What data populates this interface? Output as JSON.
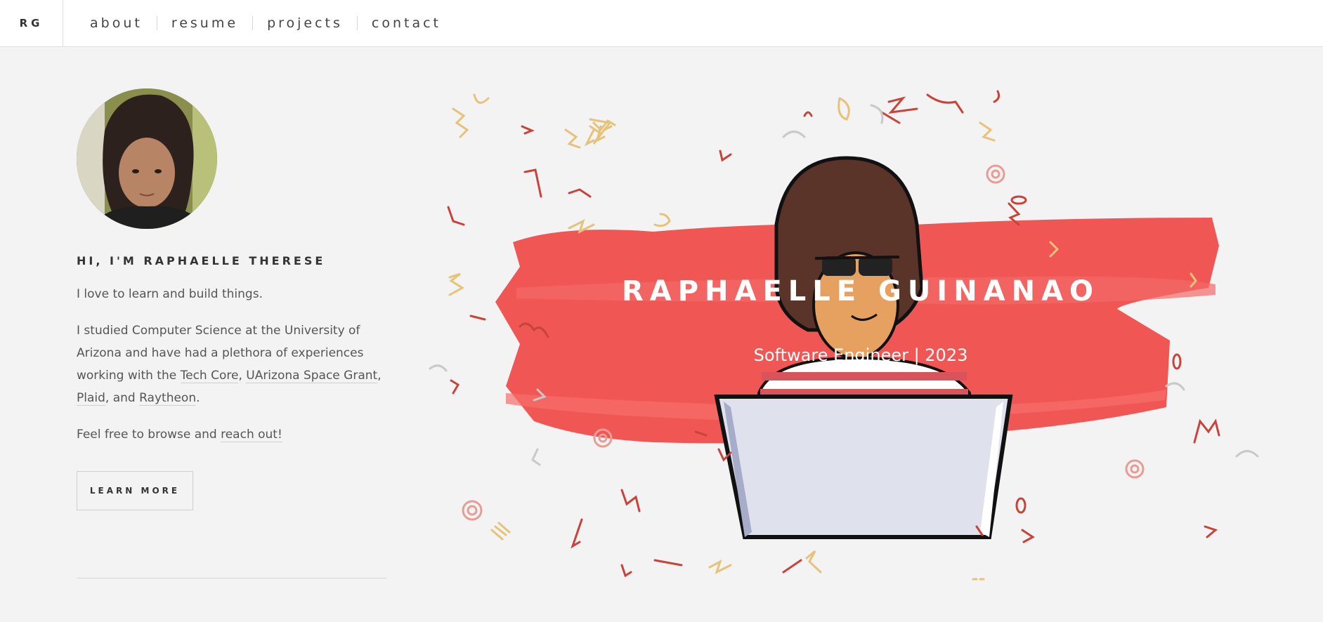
{
  "nav": {
    "brand": "RG",
    "items": [
      "about",
      "resume",
      "projects",
      "contact"
    ]
  },
  "intro": {
    "heading": "HI, I'M RAPHAELLE THERESE",
    "line1": "I love to learn and build things.",
    "p2_part1": "I studied Computer Science at the University of Arizona and have had a plethora of experiences working with the ",
    "link_tech_core": "Tech Core",
    "comma1": ",",
    "link_space_grant": "UArizona Space Grant",
    "comma2": ",",
    "link_plaid": "Plaid",
    "and_text": ", and ",
    "link_raytheon": "Raytheon",
    "period": ".",
    "p3_part1": "Feel free to browse and ",
    "link_reach_out": "reach out!",
    "button_label": "LEARN MORE"
  },
  "hero": {
    "title": "RAPHAELLE GUINANAO",
    "subtitle": "Software Engineer | 2023"
  },
  "colors": {
    "accent_red": "#f04a46",
    "doodle_red": "#c8433a",
    "doodle_gold": "#e6c27a",
    "doodle_gray": "#c9c9c9",
    "doodle_pink": "#e89c96",
    "background": "#f3f3f3"
  }
}
